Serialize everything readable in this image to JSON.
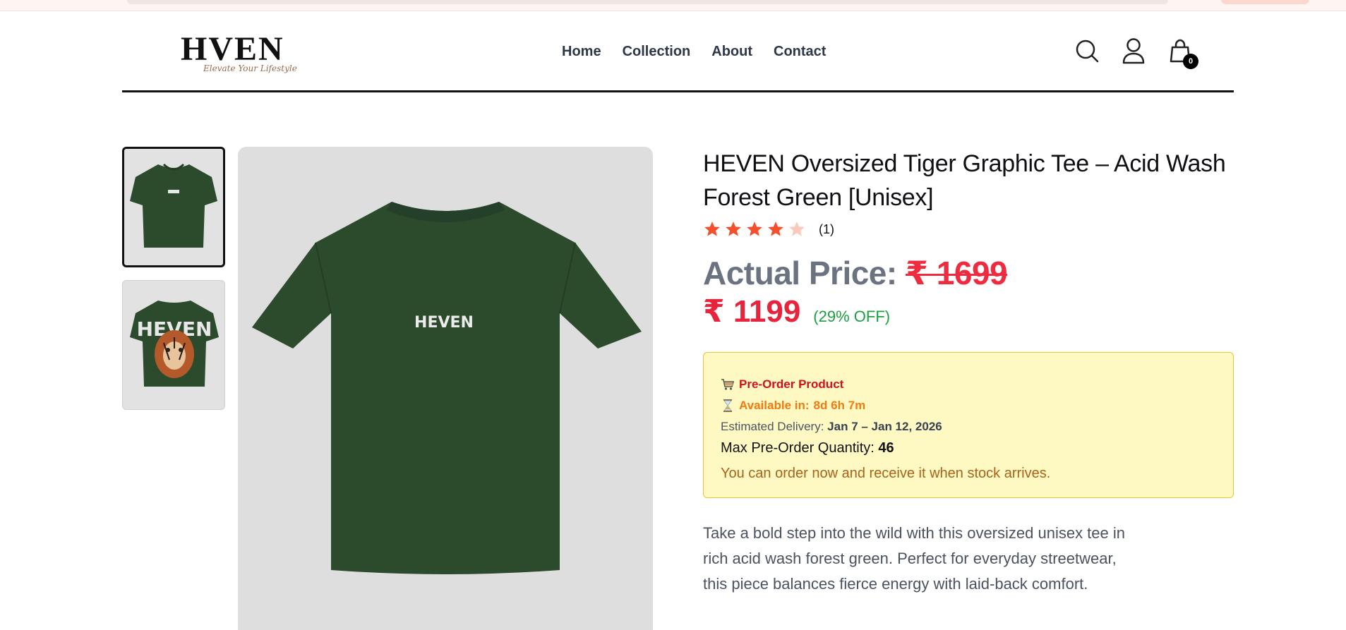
{
  "site": {
    "logo_text": "HVEN",
    "tagline": "Elevate Your Lifestyle",
    "nav": [
      "Home",
      "Collection",
      "About",
      "Contact"
    ],
    "cart_count": "0"
  },
  "icons": {
    "search": "search-icon",
    "account": "user-icon",
    "cart": "shopping-bag-icon"
  },
  "product": {
    "title": "HEVEN Oversized Tiger Graphic Tee – Acid Wash Forest Green [Unisex]",
    "rating": 4,
    "rating_max": 5,
    "review_count": "(1)",
    "actual_label": "Actual Price:",
    "actual_price": "₹ 1699",
    "price": "₹ 1199",
    "discount": "(29% OFF)",
    "image_print_text": "HEVEN",
    "description": "Take a bold step into the wild with this oversized unisex tee in rich acid wash forest green. Perfect for everyday streetwear, this piece balances fierce energy with laid-back comfort."
  },
  "preorder": {
    "title": "Pre-Order Product",
    "available_label": "Available in:",
    "available_value": "8d 6h 7m",
    "delivery_label": "Estimated Delivery:",
    "delivery_value": "Jan 7 – Jan 12, 2026",
    "max_label": "Max Pre-Order Quantity:",
    "max_value": "46",
    "note": "You can order now and receive it when stock arrives."
  },
  "colors": {
    "price_red": "#e8243c",
    "discount_green": "#1b9f3f",
    "star": "#f4502d",
    "shirt_green": "#2c4a2c",
    "preorder_bg": "#fef8c3"
  }
}
